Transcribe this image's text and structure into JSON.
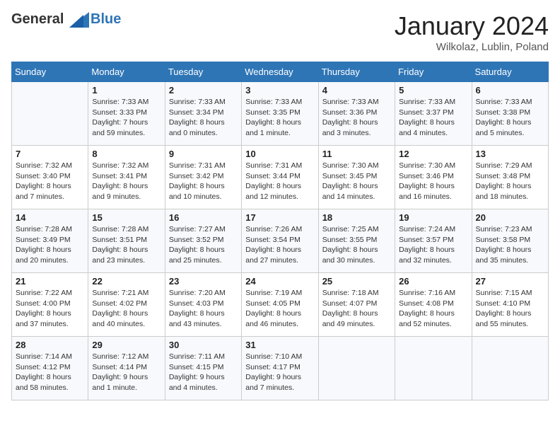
{
  "header": {
    "logo_line1": "General",
    "logo_line2": "Blue",
    "month_title": "January 2024",
    "location": "Wilkolaz, Lublin, Poland"
  },
  "days_of_week": [
    "Sunday",
    "Monday",
    "Tuesday",
    "Wednesday",
    "Thursday",
    "Friday",
    "Saturday"
  ],
  "weeks": [
    [
      {
        "day": "",
        "info": ""
      },
      {
        "day": "1",
        "info": "Sunrise: 7:33 AM\nSunset: 3:33 PM\nDaylight: 7 hours\nand 59 minutes."
      },
      {
        "day": "2",
        "info": "Sunrise: 7:33 AM\nSunset: 3:34 PM\nDaylight: 8 hours\nand 0 minutes."
      },
      {
        "day": "3",
        "info": "Sunrise: 7:33 AM\nSunset: 3:35 PM\nDaylight: 8 hours\nand 1 minute."
      },
      {
        "day": "4",
        "info": "Sunrise: 7:33 AM\nSunset: 3:36 PM\nDaylight: 8 hours\nand 3 minutes."
      },
      {
        "day": "5",
        "info": "Sunrise: 7:33 AM\nSunset: 3:37 PM\nDaylight: 8 hours\nand 4 minutes."
      },
      {
        "day": "6",
        "info": "Sunrise: 7:33 AM\nSunset: 3:38 PM\nDaylight: 8 hours\nand 5 minutes."
      }
    ],
    [
      {
        "day": "7",
        "info": "Sunrise: 7:32 AM\nSunset: 3:40 PM\nDaylight: 8 hours\nand 7 minutes."
      },
      {
        "day": "8",
        "info": "Sunrise: 7:32 AM\nSunset: 3:41 PM\nDaylight: 8 hours\nand 9 minutes."
      },
      {
        "day": "9",
        "info": "Sunrise: 7:31 AM\nSunset: 3:42 PM\nDaylight: 8 hours\nand 10 minutes."
      },
      {
        "day": "10",
        "info": "Sunrise: 7:31 AM\nSunset: 3:44 PM\nDaylight: 8 hours\nand 12 minutes."
      },
      {
        "day": "11",
        "info": "Sunrise: 7:30 AM\nSunset: 3:45 PM\nDaylight: 8 hours\nand 14 minutes."
      },
      {
        "day": "12",
        "info": "Sunrise: 7:30 AM\nSunset: 3:46 PM\nDaylight: 8 hours\nand 16 minutes."
      },
      {
        "day": "13",
        "info": "Sunrise: 7:29 AM\nSunset: 3:48 PM\nDaylight: 8 hours\nand 18 minutes."
      }
    ],
    [
      {
        "day": "14",
        "info": "Sunrise: 7:28 AM\nSunset: 3:49 PM\nDaylight: 8 hours\nand 20 minutes."
      },
      {
        "day": "15",
        "info": "Sunrise: 7:28 AM\nSunset: 3:51 PM\nDaylight: 8 hours\nand 23 minutes."
      },
      {
        "day": "16",
        "info": "Sunrise: 7:27 AM\nSunset: 3:52 PM\nDaylight: 8 hours\nand 25 minutes."
      },
      {
        "day": "17",
        "info": "Sunrise: 7:26 AM\nSunset: 3:54 PM\nDaylight: 8 hours\nand 27 minutes."
      },
      {
        "day": "18",
        "info": "Sunrise: 7:25 AM\nSunset: 3:55 PM\nDaylight: 8 hours\nand 30 minutes."
      },
      {
        "day": "19",
        "info": "Sunrise: 7:24 AM\nSunset: 3:57 PM\nDaylight: 8 hours\nand 32 minutes."
      },
      {
        "day": "20",
        "info": "Sunrise: 7:23 AM\nSunset: 3:58 PM\nDaylight: 8 hours\nand 35 minutes."
      }
    ],
    [
      {
        "day": "21",
        "info": "Sunrise: 7:22 AM\nSunset: 4:00 PM\nDaylight: 8 hours\nand 37 minutes."
      },
      {
        "day": "22",
        "info": "Sunrise: 7:21 AM\nSunset: 4:02 PM\nDaylight: 8 hours\nand 40 minutes."
      },
      {
        "day": "23",
        "info": "Sunrise: 7:20 AM\nSunset: 4:03 PM\nDaylight: 8 hours\nand 43 minutes."
      },
      {
        "day": "24",
        "info": "Sunrise: 7:19 AM\nSunset: 4:05 PM\nDaylight: 8 hours\nand 46 minutes."
      },
      {
        "day": "25",
        "info": "Sunrise: 7:18 AM\nSunset: 4:07 PM\nDaylight: 8 hours\nand 49 minutes."
      },
      {
        "day": "26",
        "info": "Sunrise: 7:16 AM\nSunset: 4:08 PM\nDaylight: 8 hours\nand 52 minutes."
      },
      {
        "day": "27",
        "info": "Sunrise: 7:15 AM\nSunset: 4:10 PM\nDaylight: 8 hours\nand 55 minutes."
      }
    ],
    [
      {
        "day": "28",
        "info": "Sunrise: 7:14 AM\nSunset: 4:12 PM\nDaylight: 8 hours\nand 58 minutes."
      },
      {
        "day": "29",
        "info": "Sunrise: 7:12 AM\nSunset: 4:14 PM\nDaylight: 9 hours\nand 1 minute."
      },
      {
        "day": "30",
        "info": "Sunrise: 7:11 AM\nSunset: 4:15 PM\nDaylight: 9 hours\nand 4 minutes."
      },
      {
        "day": "31",
        "info": "Sunrise: 7:10 AM\nSunset: 4:17 PM\nDaylight: 9 hours\nand 7 minutes."
      },
      {
        "day": "",
        "info": ""
      },
      {
        "day": "",
        "info": ""
      },
      {
        "day": "",
        "info": ""
      }
    ]
  ]
}
